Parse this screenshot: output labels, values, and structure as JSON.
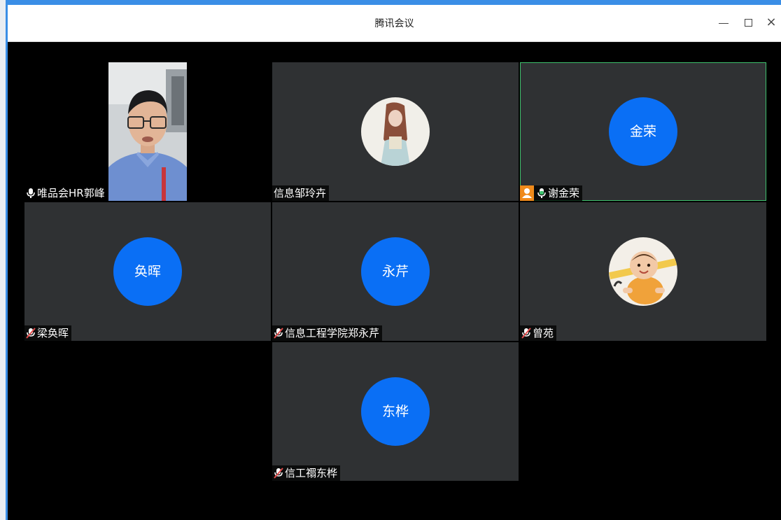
{
  "window": {
    "title": "腾讯会议",
    "min_icon": "minimize-icon",
    "max_icon": "maximize-icon",
    "close_glyph": "×"
  },
  "participants": [
    {
      "name": "唯品会HR郭峰",
      "mic": "on",
      "view": "video"
    },
    {
      "name": "信息邹玲卉",
      "mic": "none",
      "view": "photo-avatar"
    },
    {
      "name": "谢金荣",
      "avatar_text": "金荣",
      "mic": "speaking",
      "host_badge": "user-icon",
      "active_speaker": true
    },
    {
      "name": "梁奂晖",
      "avatar_text": "奂晖",
      "mic": "muted"
    },
    {
      "name": "信息工程学院郑永芹",
      "avatar_text": "永芹",
      "mic": "muted"
    },
    {
      "name": "曾苑",
      "mic": "muted",
      "view": "photo-avatar"
    },
    {
      "name": "信工禤东桦",
      "avatar_text": "东桦",
      "mic": "muted"
    }
  ],
  "colors": {
    "avatar_blue": "#0a6ff5",
    "tile_bg": "#2f3133",
    "active_border": "#3ec16d",
    "speaking_mic": "#3ec16d",
    "muted_mic": "#e24b4b",
    "host_badge": "#f08a1b"
  }
}
